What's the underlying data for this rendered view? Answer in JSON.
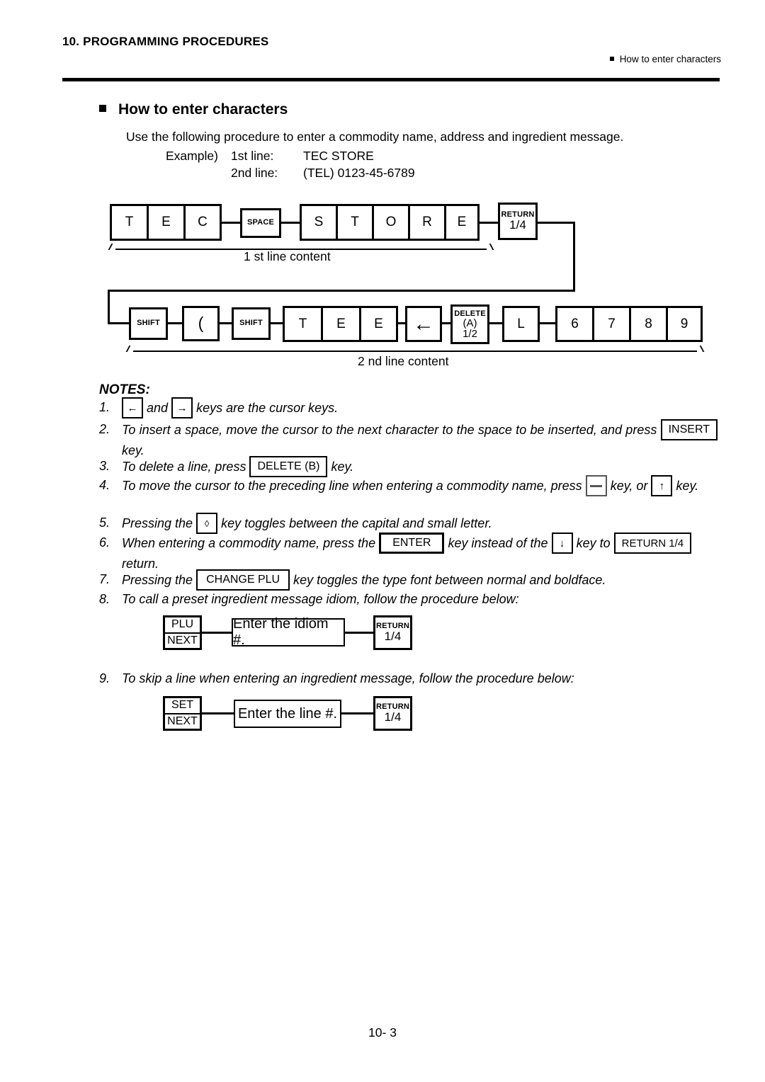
{
  "header": {
    "chapter": "10. PROGRAMMING PROCEDURES",
    "right_label": "How to enter characters"
  },
  "section": {
    "title": "How to enter characters",
    "intro": "Use the following procedure to enter a commodity name, address and ingredient message.",
    "example_label": "Example)",
    "example_rows": [
      {
        "line": "1st line:",
        "value": "TEC STORE"
      },
      {
        "line": "2nd line:",
        "value": "(TEL) 0123-45-6789"
      }
    ]
  },
  "diagram": {
    "row1": {
      "group1": [
        "T",
        "E",
        "C"
      ],
      "space_key": "SPACE",
      "group2": [
        "S",
        "T",
        "O",
        "R",
        "E"
      ],
      "return_key": {
        "top": "RETURN",
        "bottom": "1/4"
      },
      "brace_label": "1 st line content"
    },
    "row2": {
      "shift1": "SHIFT",
      "paren": "(",
      "shift2": "SHIFT",
      "group_tee": [
        "T",
        "E",
        "E"
      ],
      "left_arrow": "←",
      "delete_key": {
        "top": "DELETE",
        "mid": "(A)",
        "bottom": "1/2"
      },
      "letter_l": "L",
      "digits": [
        "6",
        "7",
        "8",
        "9"
      ],
      "brace_label": "2 nd line content"
    }
  },
  "notes": {
    "heading": "NOTES:",
    "items": [
      {
        "num": "1.",
        "parts": [
          {
            "t": "key",
            "v": "←"
          },
          {
            "t": "text",
            "v": "and"
          },
          {
            "t": "key",
            "v": "→"
          },
          {
            "t": "text",
            "v": "keys are the cursor keys."
          }
        ]
      },
      {
        "num": "2.",
        "parts": [
          {
            "t": "text",
            "v": "To insert a space, move the cursor to the next character to the space to be inserted, and press"
          },
          {
            "t": "key",
            "v": "INSERT"
          },
          {
            "t": "text",
            "v": "key."
          }
        ]
      },
      {
        "num": "3.",
        "parts": [
          {
            "t": "text",
            "v": "To delete a line, press"
          },
          {
            "t": "key",
            "v": "DELETE (B)"
          },
          {
            "t": "text",
            "v": "key."
          }
        ]
      },
      {
        "num": "4.",
        "parts": [
          {
            "t": "text",
            "v": "To move the cursor to the preceding line when entering a commodity name, press"
          },
          {
            "t": "key",
            "v": "—"
          },
          {
            "t": "text",
            "v": "key, or"
          },
          {
            "t": "key",
            "v": "↑"
          },
          {
            "t": "text",
            "v": "key."
          }
        ]
      },
      {
        "num": "5.",
        "parts": [
          {
            "t": "text",
            "v": "Pressing the"
          },
          {
            "t": "key",
            "v": "◊"
          },
          {
            "t": "text",
            "v": "key toggles between the capital and small letter."
          }
        ]
      },
      {
        "num": "6.",
        "parts": [
          {
            "t": "text",
            "v": "When entering a commodity name, press the"
          },
          {
            "t": "key",
            "v": "ENTER"
          },
          {
            "t": "text",
            "v": "key instead of the"
          },
          {
            "t": "key",
            "v": "↓"
          },
          {
            "t": "text",
            "v": "key to"
          },
          {
            "t": "key",
            "v": "RETURN 1/4"
          },
          {
            "t": "text",
            "v": "return."
          }
        ]
      },
      {
        "num": "7.",
        "parts": [
          {
            "t": "text",
            "v": "Pressing the"
          },
          {
            "t": "key",
            "v": "CHANGE PLU"
          },
          {
            "t": "text",
            "v": "key toggles the type font between normal and boldface."
          }
        ]
      },
      {
        "num": "8.",
        "parts": [
          {
            "t": "text",
            "v": "To call a preset ingredient message idiom, follow the procedure below:"
          }
        ]
      },
      {
        "num": "9.",
        "parts": [
          {
            "t": "text",
            "v": "To skip a line when entering an ingredient message, follow the procedure below:"
          }
        ]
      }
    ]
  },
  "flow8": {
    "key1_top": "PLU",
    "key1_bottom": "NEXT",
    "middle": "Enter the idiom #.",
    "key2_top": "RETURN",
    "key2_bottom": "1/4"
  },
  "flow9": {
    "key1_top": "SET",
    "key1_bottom": "NEXT",
    "middle": "Enter the line #.",
    "key2_top": "RETURN",
    "key2_bottom": "1/4"
  },
  "footer": {
    "page": "10- 3"
  }
}
